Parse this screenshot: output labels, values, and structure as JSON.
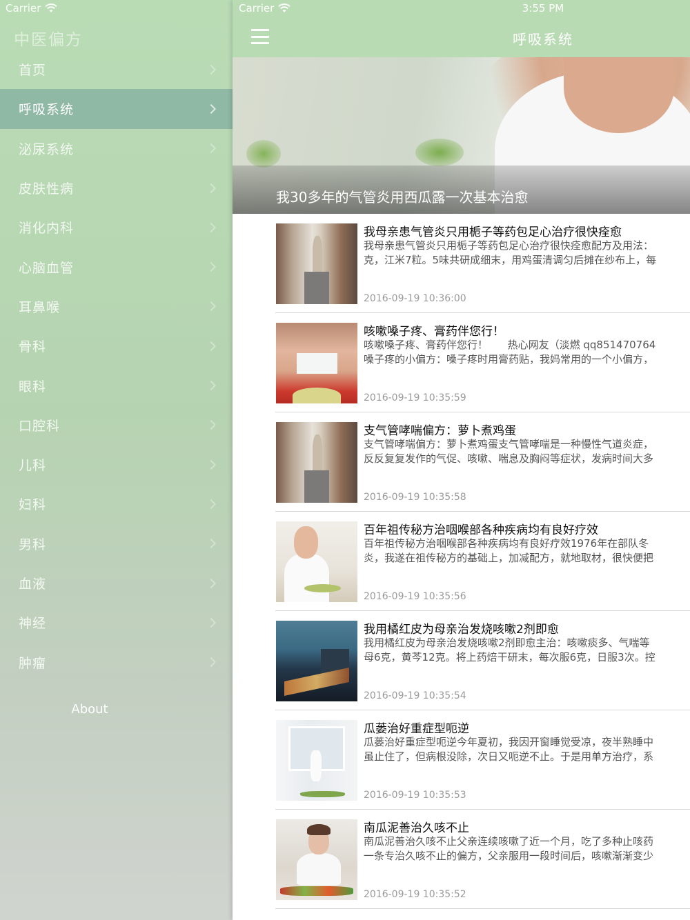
{
  "sidebar": {
    "carrier": "Carrier",
    "app_title": "中医偏方",
    "items": [
      {
        "label": "首页"
      },
      {
        "label": "呼吸系统"
      },
      {
        "label": "泌尿系统"
      },
      {
        "label": "皮肤性病"
      },
      {
        "label": "消化内科"
      },
      {
        "label": "心脑血管"
      },
      {
        "label": "耳鼻喉"
      },
      {
        "label": "骨科"
      },
      {
        "label": "眼科"
      },
      {
        "label": "口腔科"
      },
      {
        "label": "儿科"
      },
      {
        "label": "妇科"
      },
      {
        "label": "男科"
      },
      {
        "label": "血液"
      },
      {
        "label": "神经"
      },
      {
        "label": "肿瘤"
      }
    ],
    "active_index": 1,
    "about_label": "About"
  },
  "status_bar": {
    "carrier": "Carrier",
    "time": "3:55 PM"
  },
  "navbar": {
    "title": "呼吸系统",
    "menu_icon": "hamburger-icon"
  },
  "banner": {
    "title": "我30多年的气管炎用西瓜露一次基本治愈"
  },
  "articles": [
    {
      "title": "我母亲患气管炎只用栀子等药包足心治疗很快痊愈",
      "summary": "我母亲患气管炎只用栀子等药包足心治疗很快痊愈配方及用法：\n克，江米7粒。5味共研成细末，用鸡蛋清调匀后摊在纱布上，每",
      "date": "2016-09-19 10:36:00",
      "thumb": "street"
    },
    {
      "title": "咳嗽嗓子疼、膏药伴您行！",
      "summary": "咳嗽嗓子疼、膏药伴您行！      热心网友（淡燃 qq851470764\n嗓子疼的小偏方：嗓子疼时用膏药贴，我妈常用的一个小偏方，",
      "date": "2016-09-19 10:35:59",
      "thumb": "neck"
    },
    {
      "title": "支气管哮喘偏方：萝卜煮鸡蛋",
      "summary": "支气管哮喘偏方：萝卜煮鸡蛋支气管哮喘是一种慢性气道炎症，\n反反复复发作的气促、咳嗽、喘息及胸闷等症状，发病时间大多",
      "date": "2016-09-19 10:35:58",
      "thumb": "street"
    },
    {
      "title": "百年祖传秘方治咽喉部各种疾病均有良好疗效",
      "summary": "百年祖传秘方治咽喉部各种疾病均有良好疗效1976年在部队冬\n炎，我遂在祖传秘方的基础上，加减配方，就地取材，很快便把",
      "date": "2016-09-19 10:35:56",
      "thumb": "eat"
    },
    {
      "title": "我用橘红皮为母亲治发烧咳嗽2剂即愈",
      "summary": "我用橘红皮为母亲治发烧咳嗽2剂即愈主治：咳嗽痰多、气喘等\n母6克，黄芩12克。将上药焙干研末，每次服6克，日服3次。控",
      "date": "2016-09-19 10:35:54",
      "thumb": "city"
    },
    {
      "title": "瓜蒌治好重症型呃逆",
      "summary": "瓜蒌治好重症型呃逆今年夏初，我因开窗睡觉受凉，夜半熟睡中\n虽止住了，但病根没除，次日又呃逆不止。于是用单方治疗，系",
      "date": "2016-09-19 10:35:53",
      "thumb": "room"
    },
    {
      "title": "南瓜泥善治久咳不止",
      "summary": "南瓜泥善治久咳不止父亲连续咳嗽了近一个月，吃了多种止咳药\n一条专治久咳不止的偏方，父亲服用一段时间后，咳嗽渐渐变少",
      "date": "2016-09-19 10:35:52",
      "thumb": "cook"
    }
  ]
}
